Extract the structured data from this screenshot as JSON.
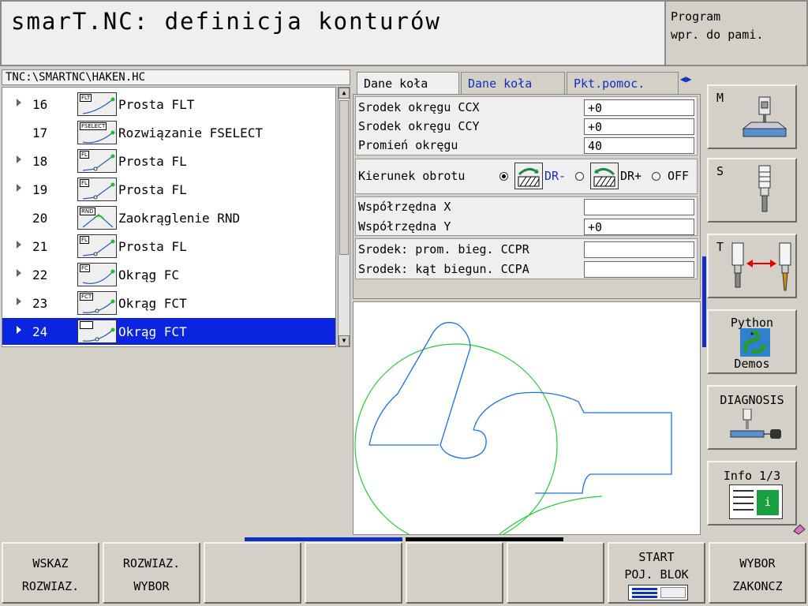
{
  "header": {
    "title": "smarT.NC: definicja konturów",
    "mode_line1": "Program",
    "mode_line2": "wpr. do pami."
  },
  "path": "TNC:\\SMARTNC\\HAKEN.HC",
  "program_rows": [
    {
      "num": "16",
      "icon": "FLT",
      "label": "Prosta FLT",
      "has_arrow": true
    },
    {
      "num": "17",
      "icon": "FSELECT",
      "label": "Rozwiązanie FSELECT",
      "has_arrow": false
    },
    {
      "num": "18",
      "icon": "FL",
      "label": "Prosta FL",
      "has_arrow": true
    },
    {
      "num": "19",
      "icon": "FL",
      "label": "Prosta FL",
      "has_arrow": true
    },
    {
      "num": "20",
      "icon": "RND",
      "label": "Zaokrąglenie RND",
      "has_arrow": false
    },
    {
      "num": "21",
      "icon": "FL",
      "label": "Prosta FL",
      "has_arrow": true
    },
    {
      "num": "22",
      "icon": "FC",
      "label": "Okrąg FC",
      "has_arrow": true
    },
    {
      "num": "23",
      "icon": "FCT",
      "label": "Okrąg FCT",
      "has_arrow": true
    },
    {
      "num": "24",
      "icon": "FCT",
      "label": "Okrąg FCT",
      "has_arrow": true
    }
  ],
  "selected_row": 8,
  "tabs": [
    "Dane koła",
    "Dane koła",
    "Pkt.pomoc."
  ],
  "form": {
    "ccx_label": "Srodek okręgu CCX",
    "ccx_value": "+0",
    "ccy_label": "Srodek okręgu CCY",
    "ccy_value": "+0",
    "radius_label": "Promień okręgu",
    "radius_value": "40",
    "direction_label": "Kierunek obrotu",
    "dir_minus": "DR-",
    "dir_plus": "DR+",
    "dir_off": "OFF",
    "dir_selected": "DR-",
    "x_label": "Współrzędna X",
    "x_value": "",
    "y_label": "Współrzędna Y",
    "y_value": "+0",
    "ccpr_label": "Srodek: prom. bieg. CCPR",
    "ccpr_value": "",
    "ccpa_label": "Srodek: kąt biegun. CCPA",
    "ccpa_value": ""
  },
  "right_softkeys": {
    "m": "M",
    "s": "S",
    "t": "T",
    "python_1": "Python",
    "python_2": "Demos",
    "diagnosis": "DIAGNOSIS",
    "info": "Info 1/3",
    "info_icon": "i"
  },
  "bottom_softkeys": [
    {
      "l1": "WSKAZ",
      "l2": "ROZWIAZ."
    },
    {
      "l1": "ROZWIAZ.",
      "l2": "WYBOR"
    },
    {
      "l1": "",
      "l2": ""
    },
    {
      "l1": "",
      "l2": ""
    },
    {
      "l1": "",
      "l2": ""
    },
    {
      "l1": "",
      "l2": ""
    },
    {
      "l1": "START",
      "l2": "POJ. BLOK"
    },
    {
      "l1": "WYBOR",
      "l2": "ZAKONCZ"
    }
  ],
  "colors": {
    "accent_blue": "#1030c0",
    "selection": "#0a24e0",
    "contour": "#1a70e0",
    "circle": "#22cc33"
  }
}
